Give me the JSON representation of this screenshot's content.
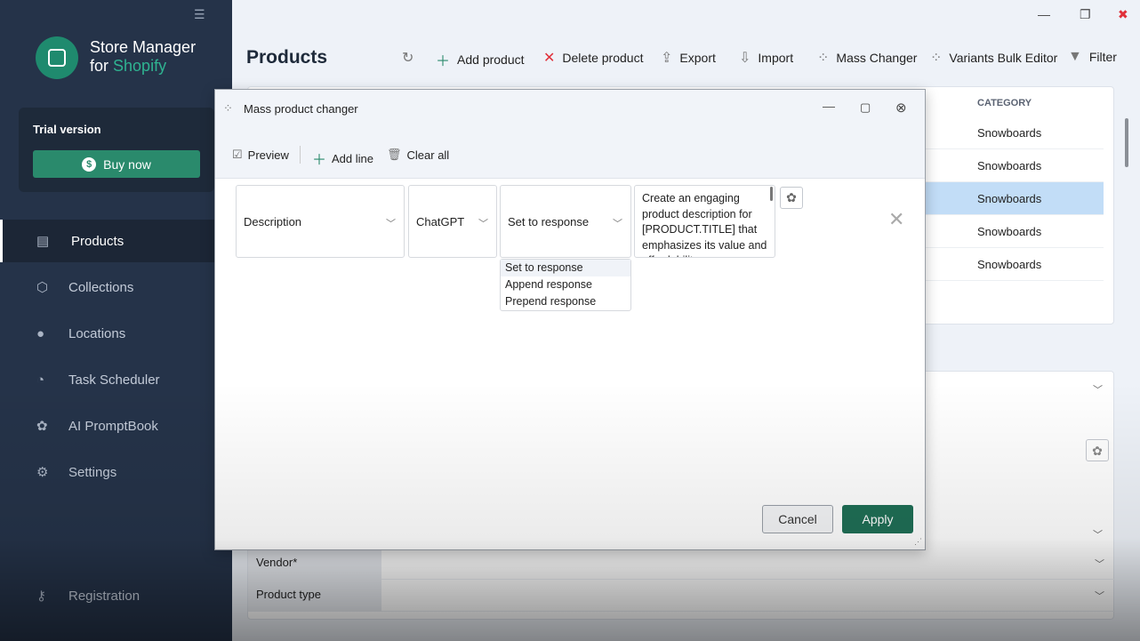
{
  "sidebar": {
    "brand_line1": "Store Manager",
    "brand_for": "for",
    "brand_shopify": "Shopify",
    "trial": "Trial version",
    "buy": "Buy now",
    "items": [
      {
        "label": "Products",
        "icon": "list-icon",
        "active": true
      },
      {
        "label": "Collections",
        "icon": "box-icon"
      },
      {
        "label": "Locations",
        "icon": "pin-icon"
      },
      {
        "label": "Task Scheduler",
        "icon": "clock-icon"
      },
      {
        "label": "AI PromptBook",
        "icon": "openai-icon"
      },
      {
        "label": "Settings",
        "icon": "gear-icon"
      }
    ],
    "registration": "Registration"
  },
  "header": {
    "title": "Products",
    "toolbar": [
      "Add product",
      "Delete product",
      "Export",
      "Import",
      "Mass Changer",
      "Variants Bulk Editor",
      "Filter"
    ]
  },
  "grid": {
    "column": "CATEGORY",
    "rows": [
      "Snowboards",
      "Snowboards",
      "Snowboards",
      "Snowboards",
      "Snowboards"
    ],
    "selected_row": 2
  },
  "form": {
    "fields": [
      "Vendor*",
      "Product type"
    ]
  },
  "dialog": {
    "title": "Mass product changer",
    "preview": "Preview",
    "add_line": "Add line",
    "clear_all": "Clear all",
    "field": "Description",
    "source": "ChatGPT",
    "action": "Set to response",
    "prompt": "Create an engaging product description for [PRODUCT.TITLE] that emphasizes its value and affordability",
    "options": [
      "Set to response",
      "Append response",
      "Prepend response"
    ],
    "cancel": "Cancel",
    "apply": "Apply"
  },
  "colors": {
    "accent": "#2a8a6c",
    "sidebar": "#253349",
    "selection": "#c2ddf7",
    "close": "#e0303a"
  }
}
